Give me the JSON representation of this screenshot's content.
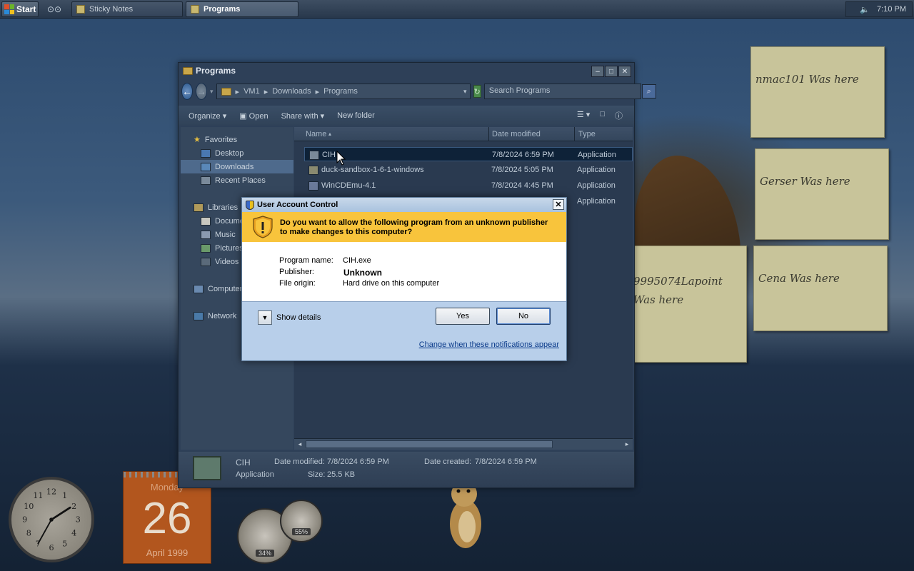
{
  "taskbar": {
    "start_label": "Start",
    "tasks": [
      {
        "label": "Sticky Notes",
        "active": false
      },
      {
        "label": "Programs",
        "active": true
      }
    ],
    "clock": "7:10 PM"
  },
  "desktop": {
    "notes": [
      "nmac101 Was here",
      "Gerser Was here",
      "9995074Lapoint\nWas here",
      "Cena Was here"
    ],
    "calendar": {
      "day_name": "Monday",
      "day": "26",
      "month_year": "April 1999"
    },
    "meters": {
      "cpu": "34%",
      "ram": "55%"
    }
  },
  "explorer": {
    "title": "Programs",
    "breadcrumb": [
      "VM1",
      "Downloads",
      "Programs"
    ],
    "search_placeholder": "Search Programs",
    "commands": [
      "Organize",
      "Open",
      "Share with",
      "New folder"
    ],
    "nav": {
      "favorites_label": "Favorites",
      "favorites": [
        "Desktop",
        "Downloads",
        "Recent Places"
      ],
      "libraries_label": "Libraries",
      "libraries": [
        "Documents",
        "Music",
        "Pictures",
        "Videos"
      ],
      "computer_label": "Computer",
      "network_label": "Network"
    },
    "columns": {
      "name": "Name",
      "date": "Date modified",
      "type": "Type"
    },
    "files": [
      {
        "name": "CIH",
        "date": "7/8/2024 6:59 PM",
        "type": "Application"
      },
      {
        "name": "duck-sandbox-1-6-1-windows",
        "date": "7/8/2024 5:05 PM",
        "type": "Application"
      },
      {
        "name": "WinCDEmu-4.1",
        "date": "7/8/2024 4:45 PM",
        "type": "Application"
      },
      {
        "name": "",
        "date": "",
        "type": "Application"
      }
    ],
    "details": {
      "name": "CIH",
      "kind": "Application",
      "date_modified_label": "Date modified:",
      "date_modified": "7/8/2024 6:59 PM",
      "size_label": "Size:",
      "size": "25.5 KB",
      "date_created_label": "Date created:",
      "date_created": "7/8/2024 6:59 PM"
    }
  },
  "uac": {
    "title": "User Account Control",
    "question": "Do you want to allow the following program from an unknown publisher to make changes to this computer?",
    "program_name_label": "Program name:",
    "program_name": "CIH.exe",
    "publisher_label": "Publisher:",
    "publisher": "Unknown",
    "file_origin_label": "File origin:",
    "file_origin": "Hard drive on this computer",
    "show_details": "Show details",
    "yes": "Yes",
    "no": "No",
    "change_link": "Change when these notifications appear"
  }
}
